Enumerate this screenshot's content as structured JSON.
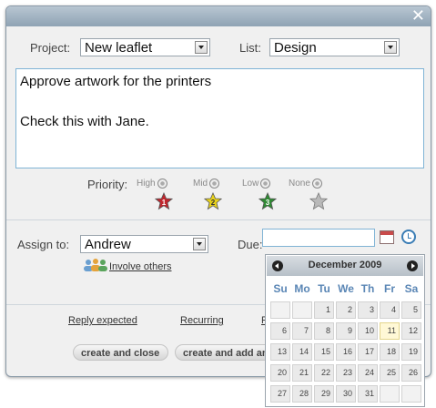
{
  "dialog": {
    "close_symbol": "✕"
  },
  "project": {
    "label": "Project:",
    "value": "New leaflet"
  },
  "list": {
    "label": "List:",
    "value": "Design"
  },
  "task_text": {
    "line1": "Approve artwork for the printers",
    "line2": "Check this with Jane."
  },
  "priority": {
    "label": "Priority:",
    "options": [
      {
        "label": "High",
        "star_number": "1",
        "color": "#c0262d"
      },
      {
        "label": "Mid",
        "star_number": "2",
        "color": "#e8d21a"
      },
      {
        "label": "Low",
        "star_number": "3",
        "color": "#2f8a33"
      },
      {
        "label": "None",
        "star_number": "",
        "color": "#b9b9b9"
      }
    ]
  },
  "assign": {
    "label": "Assign to:",
    "value": "Andrew",
    "involve_others": "Involve others"
  },
  "due": {
    "label": "Due:",
    "value": ""
  },
  "links": {
    "reply_expected": "Reply expected",
    "recurring": "Recurring",
    "third": "R"
  },
  "buttons": {
    "create_and_close": "create and close",
    "create_and_add": "create and add an"
  },
  "calendar": {
    "month_title": "December 2009",
    "weekdays": [
      "Su",
      "Mo",
      "Tu",
      "We",
      "Th",
      "Fr",
      "Sa"
    ],
    "weeks": [
      [
        "",
        "",
        "1",
        "2",
        "3",
        "4",
        "5"
      ],
      [
        "6",
        "7",
        "8",
        "9",
        "10",
        "11",
        "12"
      ],
      [
        "13",
        "14",
        "15",
        "16",
        "17",
        "18",
        "19"
      ],
      [
        "20",
        "21",
        "22",
        "23",
        "24",
        "25",
        "26"
      ],
      [
        "27",
        "28",
        "29",
        "30",
        "31",
        "",
        ""
      ]
    ],
    "highlighted_day": "11"
  }
}
